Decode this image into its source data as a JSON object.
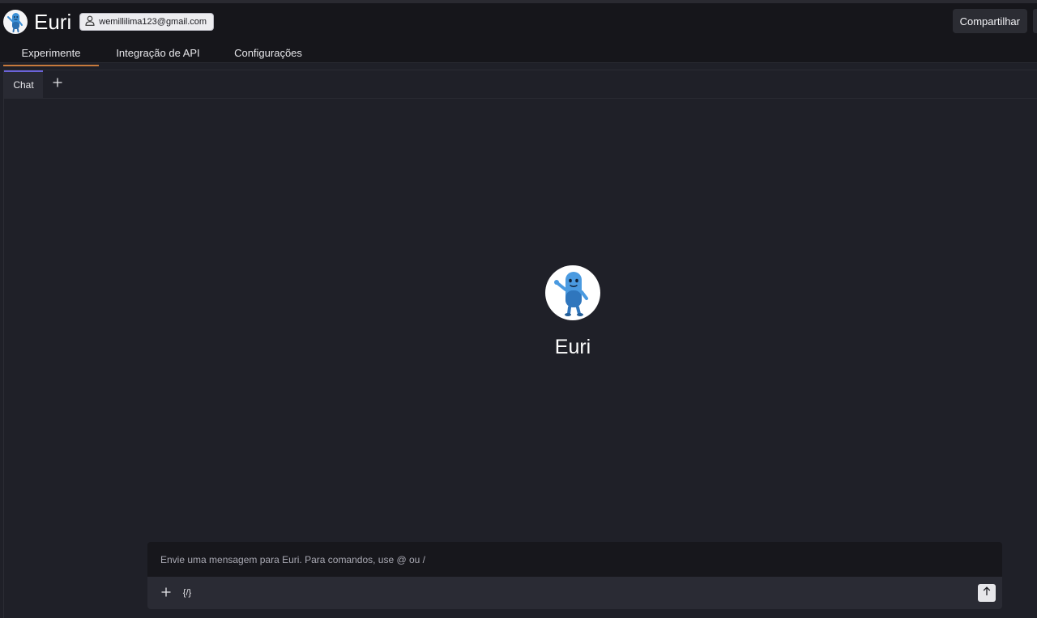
{
  "app": {
    "title": "Euri",
    "user_email": "wemillilima123@gmail.com",
    "share_label": "Compartilhar"
  },
  "nav": {
    "tabs": [
      {
        "label": "Experimente",
        "active": true
      },
      {
        "label": "Integração de API",
        "active": false
      },
      {
        "label": "Configurações",
        "active": false
      }
    ]
  },
  "subtabs": {
    "items": [
      {
        "label": "Chat",
        "active": true
      }
    ],
    "add_icon": "plus-icon"
  },
  "hero": {
    "name": "Euri",
    "avatar_icon": "mascot-pill-icon"
  },
  "composer": {
    "placeholder": "Envie uma mensagem para Euri. Para comandos, use @ ou /",
    "tools": [
      "plus-icon",
      "variables-icon"
    ],
    "variables_glyph": "{/}",
    "send_icon": "arrow-up-icon"
  },
  "colors": {
    "background": "#1f2028",
    "topbar": "#16161b",
    "accent_tab": "#c87a3c",
    "subtab_accent": "#6b63d9"
  }
}
